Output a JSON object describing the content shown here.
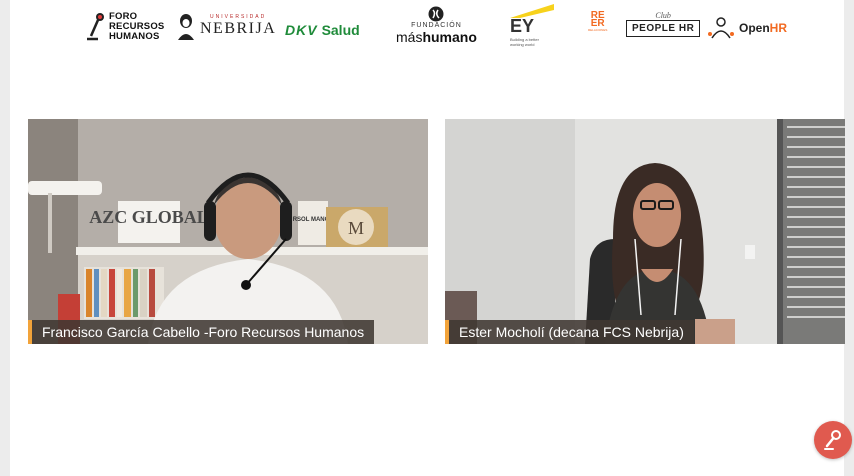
{
  "sponsors": {
    "foro": {
      "lines": [
        "FORO",
        "RECURSOS",
        "HUMANOS"
      ]
    },
    "nebrija": {
      "small": "UNIVERSIDAD",
      "name": "NEBRIJA"
    },
    "dkv": {
      "brand": "DKV",
      "name": "Salud"
    },
    "fundacion": {
      "small": "FUNDACIÓN",
      "name_light": "más",
      "name_bold": "humano"
    },
    "ey": {
      "name": "EY",
      "tagline_1": "Building a better",
      "tagline_2": "working world"
    },
    "reer": {
      "line1": "RE",
      "line2": "ER",
      "tiny": "RELACIONES"
    },
    "club": {
      "small": "Club",
      "name": "PEOPLE HR"
    },
    "openhr": {
      "name_a": "Open",
      "name_b": "HR"
    }
  },
  "participants": [
    {
      "name": "Francisco García Cabello -Foro Recursos Humanos",
      "book_sign": "AZC GLOBAL",
      "shelf_sign": "RSOL MANOS",
      "badge": "M"
    },
    {
      "name": "Ester Mocholí (decana FCS Nebrija)"
    }
  ],
  "colors": {
    "accent": "#f2a33a",
    "record": "#e05a4f",
    "reer": "#f26a21",
    "dkv": "#1f8b3a"
  },
  "icons": {
    "record": "microphone-icon"
  }
}
